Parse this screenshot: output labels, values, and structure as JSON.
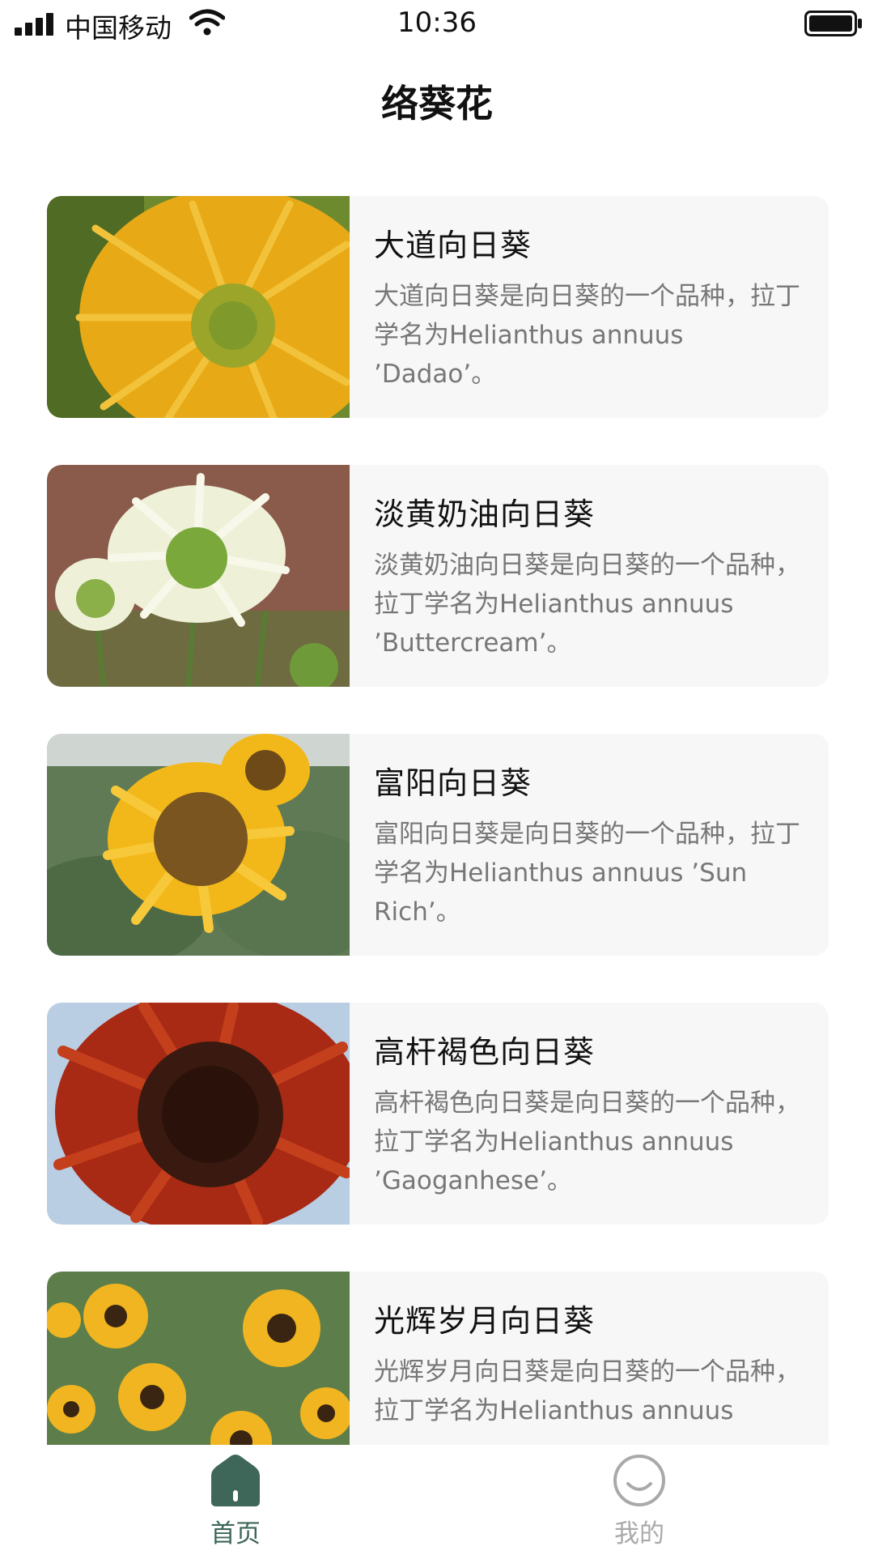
{
  "status_bar": {
    "carrier": "中国移动",
    "time": "10:36"
  },
  "page": {
    "title": "络葵花"
  },
  "theme": {
    "accent": "#3e675a",
    "inactive": "#a9a9a9",
    "card_bg": "#f7f7f7"
  },
  "list": {
    "items": [
      {
        "title": "大道向日葵",
        "desc": "大道向日葵是向日葵的一个品种，拉丁学名为Helianthus annuus ’Dadao’。",
        "image": "sunflower-closeup-yellow"
      },
      {
        "title": "淡黄奶油向日葵",
        "desc": "淡黄奶油向日葵是向日葵的一个品种，拉丁学名为Helianthus annuus ’Buttercream’。",
        "image": "sunflower-pale-cream"
      },
      {
        "title": "富阳向日葵",
        "desc": "富阳向日葵是向日葵的一个品种，拉丁学名为Helianthus annuus ’Sun Rich’。",
        "image": "sunflower-field-yellow"
      },
      {
        "title": "高杆褐色向日葵",
        "desc": "高杆褐色向日葵是向日葵的一个品种，拉丁学名为Helianthus annuus ’Gaoganhese’。",
        "image": "sunflower-red-brown"
      },
      {
        "title": "光辉岁月向日葵",
        "desc": "光辉岁月向日葵是向日葵的一个品种，拉丁学名为Helianthus annuus",
        "image": "sunflower-field-many"
      }
    ]
  },
  "tab_bar": {
    "tabs": [
      {
        "label": "首页",
        "icon": "home-icon",
        "active": true
      },
      {
        "label": "我的",
        "icon": "smile-face-icon",
        "active": false
      }
    ]
  }
}
